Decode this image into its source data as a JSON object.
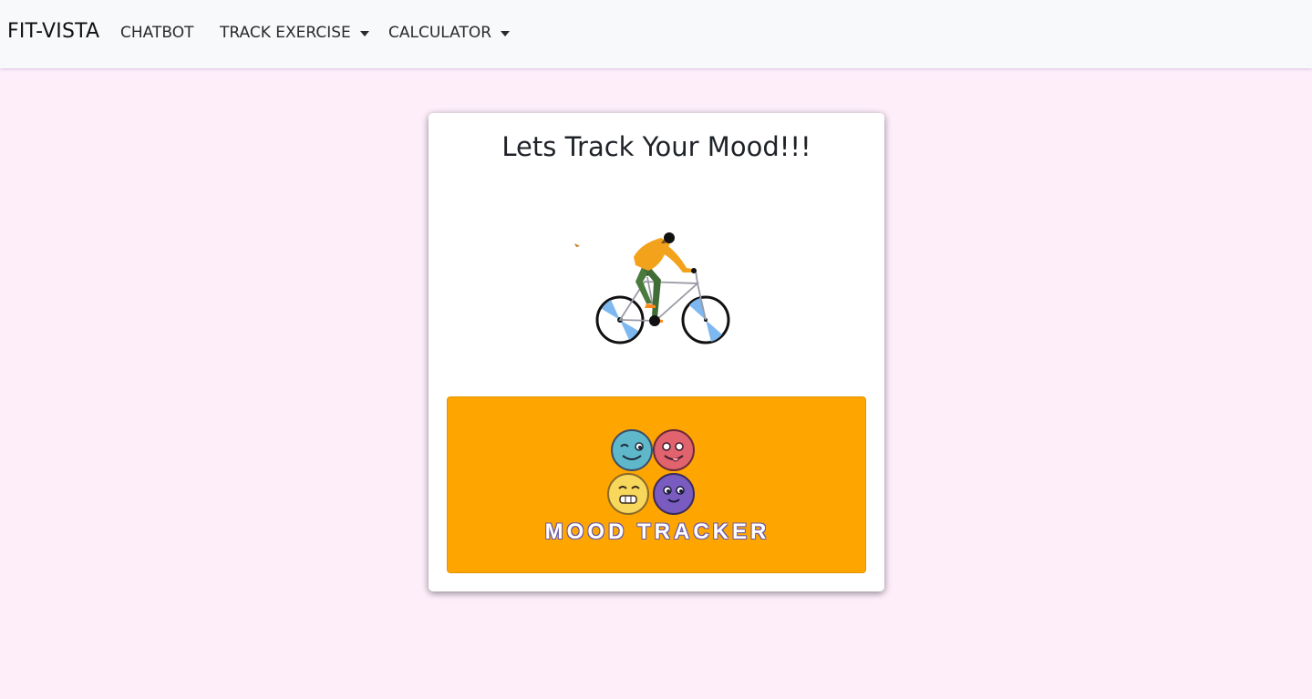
{
  "navbar": {
    "brand": "FIT-VISTA",
    "items": [
      {
        "label": "CHATBOT",
        "dropdown": false
      },
      {
        "label": "TRACK EXERCISE",
        "dropdown": true
      },
      {
        "label": "CALCULATOR",
        "dropdown": true
      }
    ]
  },
  "card": {
    "title": "Lets Track Your Mood!!!",
    "image": "cyclist-illustration",
    "button": {
      "label": "MOOD TRACKER",
      "icon": "mood-faces-icon",
      "background": "#ffa500"
    }
  },
  "colors": {
    "page_background": "#fdeefa",
    "navbar_background": "#f8f9fa",
    "accent": "#ffa500"
  }
}
